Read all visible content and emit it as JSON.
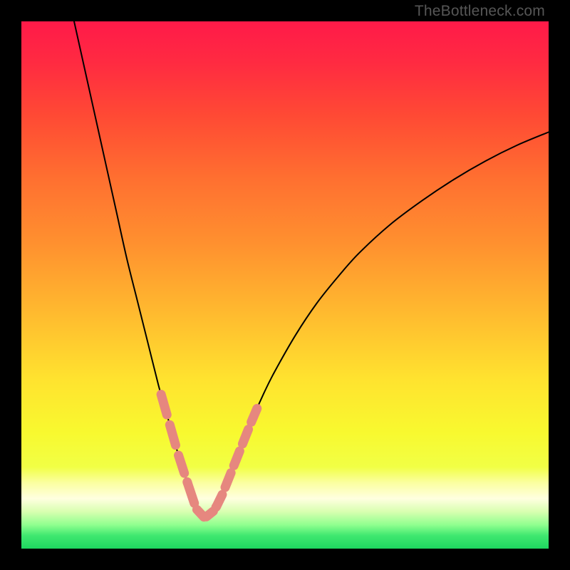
{
  "watermark": "TheBottleneck.com",
  "colors": {
    "frame": "#000000",
    "curve": "#000000",
    "bead": "#e6877f",
    "gradient_stops": [
      {
        "offset": 0.0,
        "color": "#ff1a49"
      },
      {
        "offset": 0.08,
        "color": "#ff2b41"
      },
      {
        "offset": 0.18,
        "color": "#ff4a34"
      },
      {
        "offset": 0.3,
        "color": "#ff7030"
      },
      {
        "offset": 0.42,
        "color": "#ff902f"
      },
      {
        "offset": 0.55,
        "color": "#ffb92f"
      },
      {
        "offset": 0.68,
        "color": "#ffe32f"
      },
      {
        "offset": 0.78,
        "color": "#f8f92f"
      },
      {
        "offset": 0.845,
        "color": "#f1ff45"
      },
      {
        "offset": 0.875,
        "color": "#fbffa0"
      },
      {
        "offset": 0.905,
        "color": "#ffffe0"
      },
      {
        "offset": 0.93,
        "color": "#d8ffb0"
      },
      {
        "offset": 0.955,
        "color": "#8fff8f"
      },
      {
        "offset": 0.975,
        "color": "#40e870"
      },
      {
        "offset": 1.0,
        "color": "#1ed760"
      }
    ]
  },
  "chart_data": {
    "type": "line",
    "title": "",
    "xlabel": "",
    "ylabel": "",
    "xlim": [
      0,
      100
    ],
    "ylim": [
      0,
      100
    ],
    "x_optimum": 34,
    "series": [
      {
        "name": "bottleneck-curve",
        "x": [
          10,
          12,
          14,
          16,
          18,
          20,
          22,
          24,
          26,
          27,
          28,
          29,
          30,
          31,
          32,
          33,
          34,
          35,
          36,
          37,
          38,
          39,
          40,
          42,
          44,
          46,
          48,
          52,
          56,
          60,
          64,
          70,
          76,
          82,
          88,
          94,
          100
        ],
        "y": [
          100,
          91,
          82,
          73,
          64,
          55,
          47,
          39,
          31,
          27.5,
          24,
          20.5,
          17,
          14,
          11,
          8,
          6,
          6,
          6.5,
          8,
          10,
          12.5,
          15,
          20,
          25,
          29.5,
          33.5,
          40.5,
          46.5,
          51.5,
          56,
          61.5,
          66,
          70,
          73.5,
          76.5,
          79
        ]
      }
    ],
    "beads": {
      "note": "pink dashed overlay segments on the curve near the bottom",
      "left_segment_x": [
        26.5,
        31.5
      ],
      "right_segment_x": [
        37.0,
        45.0
      ],
      "bottom_segment_x": [
        31.5,
        37.0
      ]
    }
  }
}
